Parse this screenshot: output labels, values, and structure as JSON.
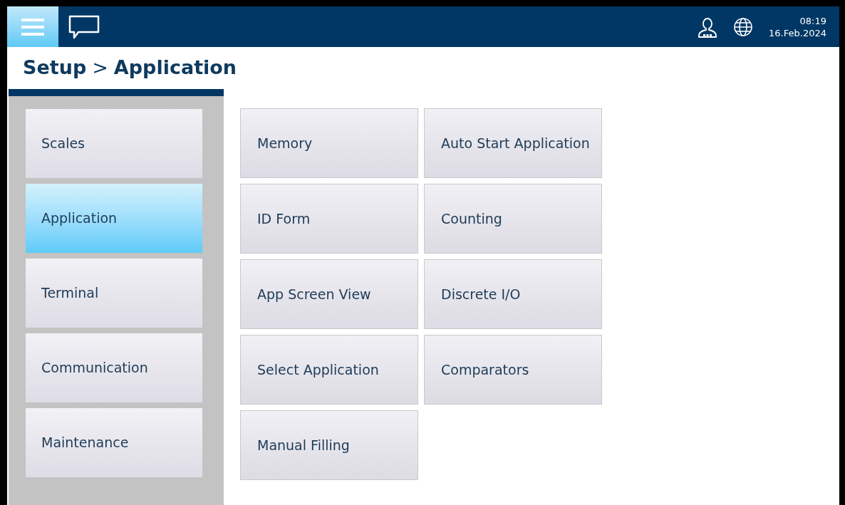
{
  "header": {
    "time": "08:19",
    "date": "16.Feb.2024"
  },
  "breadcrumb": {
    "parent": "Setup",
    "separator": ">",
    "current": "Application"
  },
  "sidebar": {
    "items": [
      {
        "label": "Scales",
        "selected": false
      },
      {
        "label": "Application",
        "selected": true
      },
      {
        "label": "Terminal",
        "selected": false
      },
      {
        "label": "Communication",
        "selected": false
      },
      {
        "label": "Maintenance",
        "selected": false
      }
    ]
  },
  "menu": {
    "items": [
      "Memory",
      "Auto Start Application",
      "ID Form",
      "Counting",
      "App Screen View",
      "Discrete I/O",
      "Select Application",
      "Comparators",
      "Manual Filling"
    ]
  }
}
